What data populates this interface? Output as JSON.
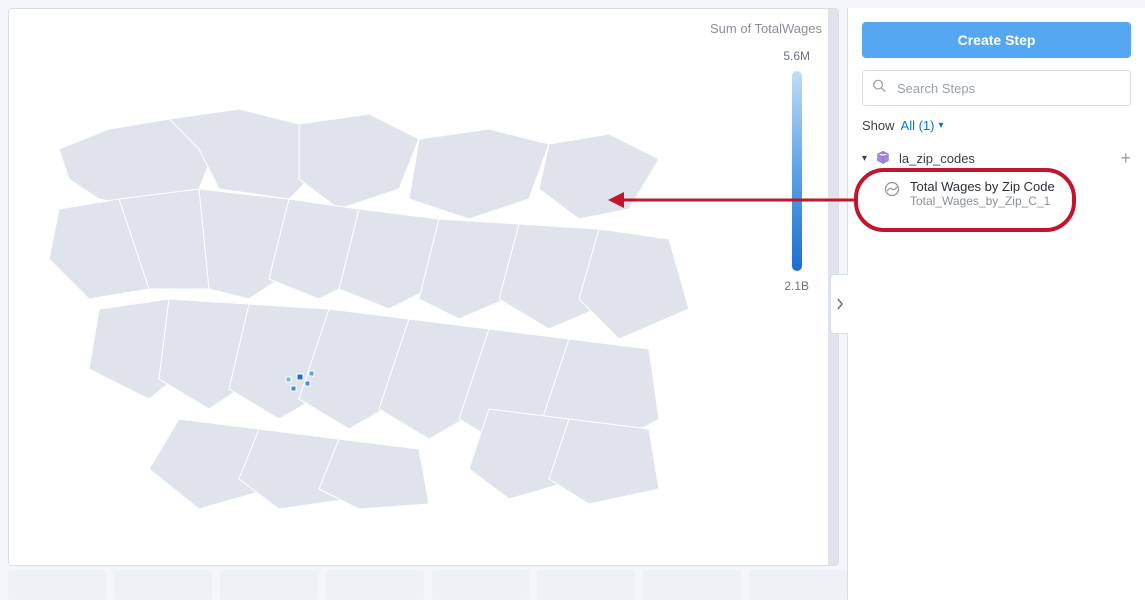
{
  "map": {
    "title": "Sum of TotalWages",
    "legend_max": "5.6M",
    "legend_min": "2.1B"
  },
  "sidebar": {
    "create_label": "Create Step",
    "search_placeholder": "Search Steps",
    "show_label": "Show",
    "show_filter": "All (1)",
    "group": {
      "name": "la_zip_codes"
    },
    "step": {
      "title": "Total Wages by Zip Code",
      "id": "Total_Wages_by_Zip_C_1"
    }
  }
}
